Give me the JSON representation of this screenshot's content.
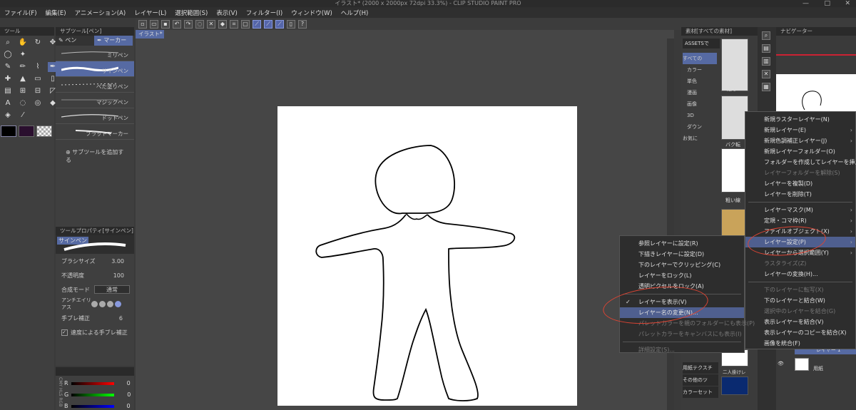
{
  "title": "イラスト* (2000 x 2000px 72dpi 33.3%) - CLIP STUDIO PAINT PRO",
  "window_controls": [
    "—",
    "□",
    "✕"
  ],
  "menubar": [
    "ファイル(F)",
    "編集(E)",
    "アニメーション(A)",
    "レイヤー(L)",
    "選択範囲(S)",
    "表示(V)",
    "フィルター(I)",
    "ウィンドウ(W)",
    "ヘルプ(H)"
  ],
  "canvas_tab": "イラスト*",
  "tool_panel": {
    "header": "ツール"
  },
  "subtool_panel": {
    "header": "サブツール[ペン]",
    "tabs": [
      "ペン",
      "マーカー"
    ],
    "brushes": [
      "ミリペン",
      "サインペン",
      "べた塗りペン",
      "マジックペン",
      "ドットペン",
      "フラットマーカー"
    ],
    "selected": "サインペン",
    "add_label": "サブツールを追加する"
  },
  "tool_property": {
    "header": "ツールプロパティ[サインペン]",
    "tool_name": "サインペン",
    "brush_size_label": "ブラシサイズ",
    "brush_size_value": "3.00",
    "opacity_label": "不透明度",
    "opacity_value": "100",
    "blend_label": "合成モード",
    "blend_value": "通常",
    "antialias_label": "アンチエイリアス",
    "stabilization_label": "手ブレ補正",
    "stabilization_value": "6",
    "speed_stab_label": "速度による手ブレ補正"
  },
  "color_panel": {
    "labels": [
      "R",
      "G",
      "B"
    ],
    "values": [
      "0",
      "0",
      "0"
    ],
    "tabs": [
      "RGB",
      "HLS",
      "CMY"
    ]
  },
  "material_panel": {
    "header": "素材[すべての素材]",
    "assets_label": "ASSETSで",
    "tree": [
      "すべての",
      "カラー",
      "単色",
      "漫画",
      "画像",
      "3D",
      "ダウン",
      "お気に"
    ],
    "thumb_labels": [
      "走る",
      "バク転",
      "粗い線"
    ],
    "bottom_items": [
      "用紙テクスチ",
      "その他のツ",
      "カラーセット"
    ],
    "bottom_thumb_labels": [
      "二人掛けレ"
    ]
  },
  "navigator": {
    "header": "ナビゲーター"
  },
  "layer_list": {
    "items": [
      "レイヤー 1",
      "用紙"
    ]
  },
  "layer_menu": {
    "items": [
      {
        "label": "新規ラスターレイヤー(N)",
        "arrow": false,
        "disabled": false
      },
      {
        "label": "新規レイヤー(E)",
        "arrow": true,
        "disabled": false
      },
      {
        "label": "新規色調補正レイヤー(J)",
        "arrow": true,
        "disabled": false
      },
      {
        "label": "新規レイヤーフォルダー(O)",
        "arrow": false,
        "disabled": false
      },
      {
        "label": "フォルダーを作成してレイヤーを挿入(F)",
        "arrow": false,
        "disabled": false
      },
      {
        "label": "レイヤーフォルダーを解除(S)",
        "arrow": false,
        "disabled": true
      },
      {
        "label": "レイヤーを複製(D)",
        "arrow": false,
        "disabled": false
      },
      {
        "label": "レイヤーを削除(T)",
        "arrow": false,
        "disabled": false
      },
      {
        "sep": true
      },
      {
        "label": "レイヤーマスク(M)",
        "arrow": true,
        "disabled": false
      },
      {
        "label": "定規・コマ枠(R)",
        "arrow": true,
        "disabled": false
      },
      {
        "label": "ファイルオブジェクト(X)",
        "arrow": true,
        "disabled": false
      },
      {
        "label": "レイヤー設定(P)",
        "arrow": true,
        "disabled": false,
        "highlight": true
      },
      {
        "label": "レイヤーから選択範囲(Y)",
        "arrow": true,
        "disabled": false
      },
      {
        "label": "ラスタライズ(Z)",
        "arrow": false,
        "disabled": true
      },
      {
        "label": "レイヤーの変換(H)...",
        "arrow": false,
        "disabled": false
      },
      {
        "sep": true
      },
      {
        "label": "下のレイヤーに転写(X)",
        "arrow": false,
        "disabled": true
      },
      {
        "label": "下のレイヤーと結合(W)",
        "arrow": false,
        "disabled": false
      },
      {
        "label": "選択中のレイヤーを結合(G)",
        "arrow": false,
        "disabled": true
      },
      {
        "label": "表示レイヤーを結合(V)",
        "arrow": false,
        "disabled": false
      },
      {
        "label": "表示レイヤーのコピーを結合(X)",
        "arrow": false,
        "disabled": false
      },
      {
        "label": "画像を統合(F)",
        "arrow": false,
        "disabled": false
      }
    ]
  },
  "sub_menu": {
    "items": [
      {
        "label": "参照レイヤーに設定(R)",
        "disabled": false
      },
      {
        "label": "下描きレイヤーに設定(D)",
        "disabled": false
      },
      {
        "label": "下のレイヤーでクリッピング(C)",
        "disabled": false
      },
      {
        "label": "レイヤーをロック(L)",
        "disabled": false
      },
      {
        "label": "透明ピクセルをロック(A)",
        "disabled": false
      },
      {
        "sep": true
      },
      {
        "label": "レイヤーを表示(V)",
        "disabled": false,
        "checked": true
      },
      {
        "label": "レイヤー名の変更(N)...",
        "disabled": false,
        "highlight": true
      },
      {
        "label": "パレットカラーを親のフォルダーにも表示(P)",
        "disabled": true
      },
      {
        "label": "パレットカラーをキャンバスにも表示(I)",
        "disabled": true
      },
      {
        "sep": true
      },
      {
        "label": "詳細設定(S)...",
        "disabled": true
      }
    ]
  },
  "colors": {
    "highlight": "#4f5f8f",
    "annotation": "#dd3322",
    "selected_brush": "#566aa3"
  }
}
